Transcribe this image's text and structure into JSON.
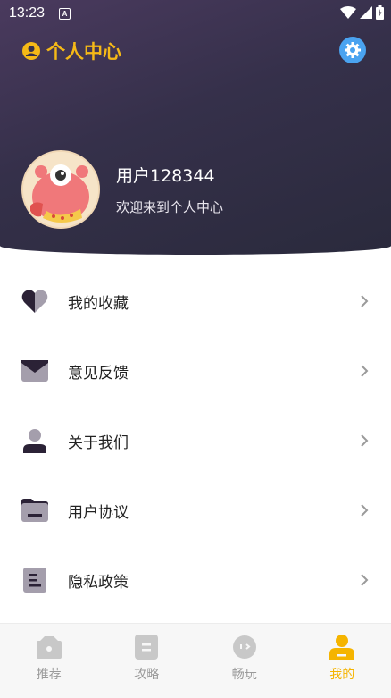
{
  "status_bar": {
    "time": "13:23",
    "badge": "A"
  },
  "header": {
    "title": "个人中心",
    "username": "用户128344",
    "welcome": "欢迎来到个人中心"
  },
  "menu": [
    {
      "label": "我的收藏",
      "icon": "heart-icon"
    },
    {
      "label": "意见反馈",
      "icon": "envelope-icon"
    },
    {
      "label": "关于我们",
      "icon": "person-icon"
    },
    {
      "label": "用户协议",
      "icon": "folder-icon"
    },
    {
      "label": "隐私政策",
      "icon": "document-icon"
    }
  ],
  "tabs": [
    {
      "label": "推荐",
      "icon": "camera-icon",
      "active": false
    },
    {
      "label": "攻略",
      "icon": "notes-icon",
      "active": false
    },
    {
      "label": "畅玩",
      "icon": "face-icon",
      "active": false
    },
    {
      "label": "我的",
      "icon": "user-icon",
      "active": true
    }
  ],
  "colors": {
    "accent": "#f5b400",
    "header_dark": "#2a2a3c",
    "settings_blue": "#4aa3f0",
    "icon_dark": "#2b2236"
  }
}
